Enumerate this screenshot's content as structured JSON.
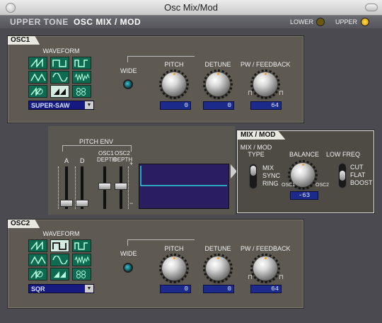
{
  "window": {
    "title": "Osc Mix/Mod"
  },
  "header": {
    "tone": "UPPER  TONE",
    "page": "OSC MIX / MOD",
    "lower_label": "LOWER",
    "upper_label": "UPPER",
    "lower_led": "#6a5a10",
    "upper_led": "#ffcc10"
  },
  "osc1": {
    "tab": "OSC1",
    "waveform_label": "WAVEFORM",
    "waveform_value": "SUPER-SAW",
    "wide_label": "WIDE",
    "pitch_label": "PITCH",
    "pitch_value": "0",
    "detune_label": "DETUNE",
    "detune_value": "0",
    "pw_label": "PW / FEEDBACK",
    "pw_value": "64"
  },
  "pitch_env": {
    "title": "PITCH ENV",
    "a": "A",
    "d": "D",
    "osc1": "OSC1",
    "osc2": "OSC2",
    "depth": "DEPTH",
    "plus": "+",
    "minus": "−"
  },
  "mixmod": {
    "tab": "MIX / MOD",
    "type_label_1": "MIX / MOD",
    "type_label_2": "TYPE",
    "types": [
      "MIX",
      "SYNC",
      "RING"
    ],
    "balance_label": "BALANCE",
    "balance_value": "-63",
    "balance_min": "OSC1",
    "balance_max": "OSC2",
    "lowfreq_label": "LOW FREQ",
    "lowfreq_opts": [
      "CUT",
      "FLAT",
      "BOOST"
    ]
  },
  "osc2": {
    "tab": "OSC2",
    "waveform_label": "WAVEFORM",
    "waveform_value": "SQR",
    "wide_label": "WIDE",
    "pitch_label": "PITCH",
    "pitch_value": "0",
    "detune_label": "DETUNE",
    "detune_value": "0",
    "pw_label": "PW / FEEDBACK",
    "pw_value": "64"
  },
  "icons": {
    "dropdown": "chevron-down-icon",
    "waveforms": [
      "saw-wave-icon",
      "square-wave-icon",
      "pulse-wave-icon",
      "triangle-wave-icon",
      "sine-wave-icon",
      "noise-wave-icon",
      "feedback-osc-icon",
      "super-saw-icon",
      "pcm-icon"
    ]
  }
}
